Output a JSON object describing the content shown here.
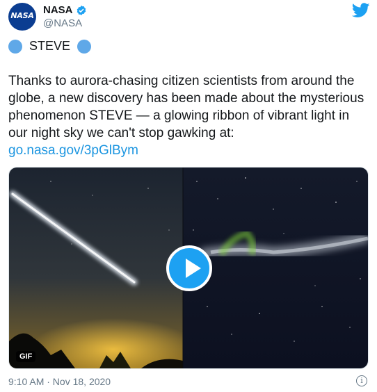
{
  "author": {
    "display_name": "NASA",
    "handle": "@NASA",
    "avatar_text": "NASA"
  },
  "icons": {
    "verified": "verified-badge-icon",
    "brand": "twitter-bird-icon",
    "play": "play-icon",
    "info": "info-icon",
    "emoji": "blue-circle-emoji"
  },
  "colors": {
    "brand": "#1da1f2",
    "link": "#1b95e0",
    "secondary_text": "#657786",
    "emoji_circle": "#5fa8e8"
  },
  "tweet": {
    "title_line": "STEVE",
    "body": "Thanks to aurora-chasing citizen scientists from around the globe, a new discovery has been made about the mysterious phenomenon STEVE — a glowing ribbon of vibrant light in our night sky we can't stop gawking at:",
    "link": "go.nasa.gov/3pGlBym",
    "media_badge": "GIF",
    "timestamp": "9:10 AM · Nov 18, 2020",
    "info_glyph": "i"
  }
}
